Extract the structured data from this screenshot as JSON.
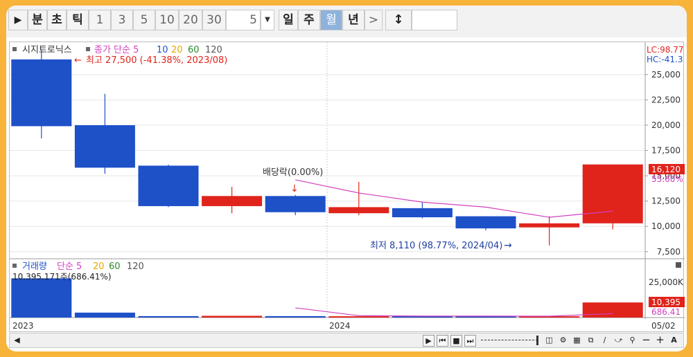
{
  "toolbar": {
    "play_icon": "play-icon",
    "buttons": [
      "분",
      "초",
      "틱",
      "1",
      "3",
      "5",
      "10",
      "20",
      "30"
    ],
    "count_value": "5",
    "period_buttons": [
      "일",
      "주",
      "월",
      "년"
    ],
    "selected_period": "월",
    "next_label": ">",
    "scale_icon": "vertical-resize-icon"
  },
  "price_panel": {
    "stock_name": "시지트로닉스",
    "ma_label": "종가 단순 5",
    "ma_periods": [
      "10",
      "20",
      "60",
      "120"
    ],
    "annotation_high": "최고 27,500 (-41.38%, 2023/08)",
    "annotation_low": "최저 8,110 (98.77%, 2024/04)",
    "annotation_dividend": "배당락(0.00%)",
    "right_top_lc": "LC:98.77",
    "right_top_hc": "HC:-41.3",
    "y_ticks": [
      "25,000",
      "22,500",
      "20,000",
      "17,500",
      "15,000",
      "12,500",
      "10,000",
      "7,500"
    ],
    "price_tag": "16,120",
    "ma_tag": "55.60%"
  },
  "volume_panel": {
    "title": "거래량",
    "ma_label": "단순 5",
    "ma_periods": [
      "20",
      "60",
      "120"
    ],
    "info": "10,395,171주(686.41%)",
    "y_ticks": [
      "25,000K"
    ],
    "volume_tag": "10,395",
    "ma_tag": "686.41"
  },
  "x_axis": {
    "labels": [
      "2023",
      "2024"
    ],
    "current_label": "05/02"
  },
  "colors": {
    "up": "#e0241c",
    "down": "#1e50c8",
    "ma": "#d040c0",
    "accent_frame": "#f7b33a"
  },
  "chart_data": {
    "type": "candlestick",
    "series": [
      {
        "name": "price",
        "candles": [
          {
            "open": 26500,
            "close": 19900,
            "high": 27500,
            "low": 18700,
            "dir": "down"
          },
          {
            "open": 20000,
            "close": 15800,
            "high": 23100,
            "low": 15200,
            "dir": "down"
          },
          {
            "open": 16000,
            "close": 12000,
            "high": 16100,
            "low": 11900,
            "dir": "down"
          },
          {
            "open": 12000,
            "close": 13000,
            "high": 13900,
            "low": 11300,
            "dir": "up"
          },
          {
            "open": 13000,
            "close": 11400,
            "high": 13100,
            "low": 11100,
            "dir": "down"
          },
          {
            "open": 11300,
            "close": 11900,
            "high": 14400,
            "low": 11100,
            "dir": "up"
          },
          {
            "open": 11800,
            "close": 10900,
            "high": 12400,
            "low": 10800,
            "dir": "down"
          },
          {
            "open": 11000,
            "close": 9800,
            "high": 11000,
            "low": 9600,
            "dir": "down"
          },
          {
            "open": 9900,
            "close": 10300,
            "high": 11000,
            "low": 8110,
            "dir": "up"
          },
          {
            "open": 10300,
            "close": 16120,
            "high": 16120,
            "low": 9700,
            "dir": "up"
          }
        ]
      },
      {
        "name": "ma5",
        "values": [
          null,
          null,
          null,
          null,
          14600,
          13300,
          12400,
          11900,
          10900,
          11500
        ]
      }
    ],
    "volume": {
      "values": [
        27000,
        3400,
        1000,
        1200,
        1000,
        900,
        900,
        900,
        900,
        10395
      ],
      "dirs": [
        "down",
        "down",
        "down",
        "up",
        "down",
        "up",
        "down",
        "down",
        "up",
        "up"
      ],
      "ma5": [
        null,
        null,
        null,
        null,
        6700,
        1300,
        1000,
        1000,
        950,
        2700
      ]
    },
    "ylim": [
      6800,
      28200
    ],
    "vol_ylim": [
      0,
      30000
    ]
  }
}
